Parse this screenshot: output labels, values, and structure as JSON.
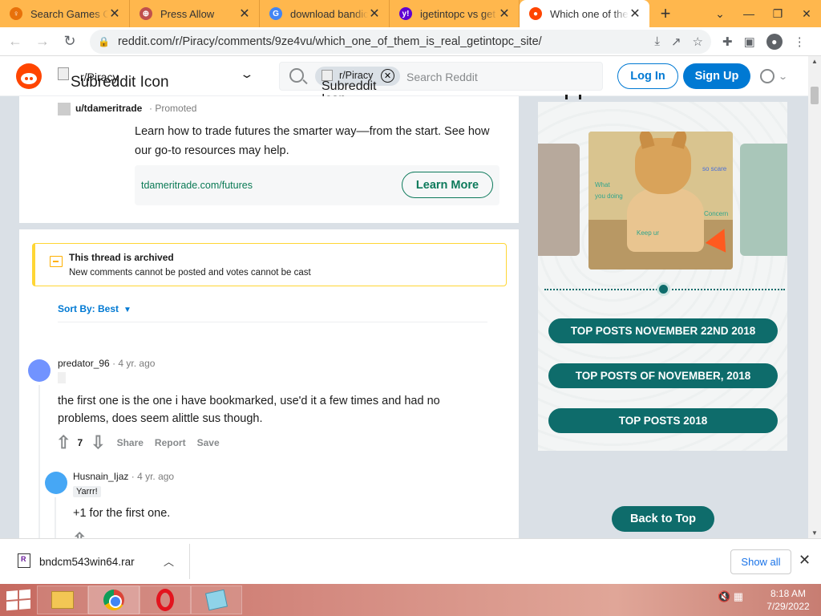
{
  "browser": {
    "tabs": [
      {
        "title": "Search Games Or",
        "color": "#e8710a",
        "glyph": "♀"
      },
      {
        "title": "Press Allow",
        "color": "#c0504d",
        "glyph": "⊕"
      },
      {
        "title": "download bandic",
        "color": "#4285f4",
        "glyph": "G"
      },
      {
        "title": "igetintopc vs get",
        "color": "#6001d2",
        "glyph": "y!"
      },
      {
        "title": "Which one of the",
        "color": "#ff4500",
        "glyph": "●"
      }
    ],
    "new_tab_glyph": "+",
    "url": "reddit.com/r/Piracy/comments/9ze4vu/which_one_of_them_is_real_getintopc_site/"
  },
  "reddit_header": {
    "subreddit": "r/Piracy",
    "subreddit_icon_alt": "Subreddit Icon",
    "search_chip": "r/Piracy",
    "search_chip_icon_alt": "Subreddit Icon",
    "search_placeholder": "Search Reddit",
    "login": "Log In",
    "signup": "Sign Up"
  },
  "promo": {
    "user": "u/tdameritrade",
    "sep": "·",
    "tag": "Promoted",
    "body": "Learn how to trade futures the smarter way––from the start. See how our go-to resources may help.",
    "link": "tdameritrade.com/futures",
    "cta": "Learn More"
  },
  "archived": {
    "title": "This thread is archived",
    "subtitle": "New comments cannot be posted and votes cannot be cast"
  },
  "sort": {
    "label": "Sort By: Best"
  },
  "comments": [
    {
      "user": "predator_96",
      "age": "4 yr. ago",
      "body": "the first one is the one i have bookmarked, use'd it a few times and had no problems, does seem alittle sus though.",
      "votes": "7",
      "actions": [
        "Share",
        "Report",
        "Save"
      ]
    },
    {
      "user": "Husnain_Ijaz",
      "age": "4 yr. ago",
      "flair": "Yarrr!",
      "body": "+1 for the first one."
    }
  ],
  "sidebar": {
    "buttons": [
      "TOP POSTS NOVEMBER 22ND 2018",
      "TOP POSTS OF NOVEMBER, 2018",
      "TOP POSTS 2018"
    ],
    "meme_captions": [
      "What",
      "you doing",
      "so scare",
      "Concern",
      "Keep ur"
    ]
  },
  "back_to_top": "Back to Top",
  "download_bar": {
    "file": "bndcm543win64.rar",
    "show_all": "Show all"
  },
  "taskbar": {
    "time": "8:18 AM",
    "date": "7/29/2022"
  }
}
